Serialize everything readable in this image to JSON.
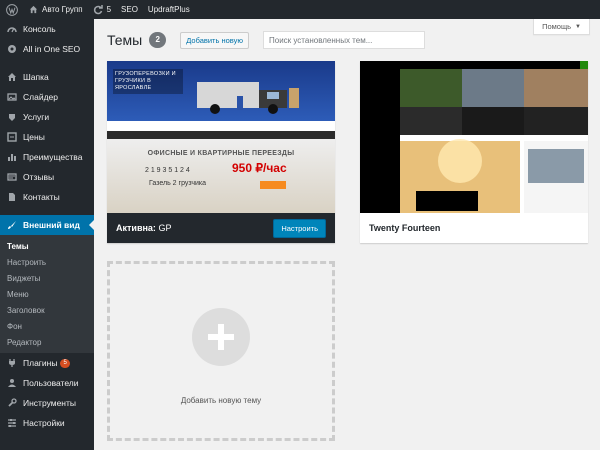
{
  "adminbar": {
    "items": [
      {
        "label": "Авто Групп"
      },
      {
        "label": "5"
      },
      {
        "label": "SEO"
      },
      {
        "label": "UpdraftPlus"
      }
    ]
  },
  "sidebar": {
    "items": [
      {
        "label": "Консоль",
        "icon": "dashboard-icon"
      },
      {
        "label": "All in One SEO",
        "icon": "seo-icon"
      },
      {
        "label": "Шапка",
        "icon": "home-icon"
      },
      {
        "label": "Слайдер",
        "icon": "image-icon"
      },
      {
        "label": "Услуги",
        "icon": "services-icon"
      },
      {
        "label": "Цены",
        "icon": "price-icon"
      },
      {
        "label": "Преимущества",
        "icon": "chart-icon"
      },
      {
        "label": "Отзывы",
        "icon": "reviews-icon"
      },
      {
        "label": "Контакты",
        "icon": "contacts-icon"
      },
      {
        "label": "Внешний вид",
        "icon": "paintbrush-icon"
      }
    ],
    "submenu": [
      "Темы",
      "Настроить",
      "Виджеты",
      "Меню",
      "Заголовок",
      "Фон",
      "Редактор"
    ],
    "bottom": [
      {
        "label": "Плагины",
        "icon": "plugin-icon",
        "badge": "5"
      },
      {
        "label": "Пользователи",
        "icon": "users-icon"
      },
      {
        "label": "Инструменты",
        "icon": "tools-icon"
      },
      {
        "label": "Настройки",
        "icon": "settings-icon"
      }
    ]
  },
  "main": {
    "help": "Помощь",
    "title": "Темы",
    "count": "2",
    "add_new": "Добавить новую",
    "search_placeholder": "Поиск установленных тем...",
    "themes": [
      {
        "active_prefix": "Активна:",
        "name": "GP",
        "customize": "Настроить"
      },
      {
        "name": "Twenty Fourteen"
      }
    ],
    "add_theme_label": "Добавить новую тему"
  },
  "gp_preview": {
    "headline": "ГРУЗОПЕРЕВОЗКИ И ГРУЗЧИКИ В ЯРОСЛАВЛЕ",
    "hero_title": "ОФИСНЫЕ И КВАРТИРНЫЕ ПЕРЕЕЗДЫ",
    "price": "950 ₽/час",
    "line1": "2 1 9 3 5 1 2 4",
    "line2": "Газель 2 грузчика"
  },
  "colors": {
    "admin_bg": "#23282d",
    "accent": "#0073aa",
    "button": "#0085ba",
    "badge": "#d54e21"
  }
}
